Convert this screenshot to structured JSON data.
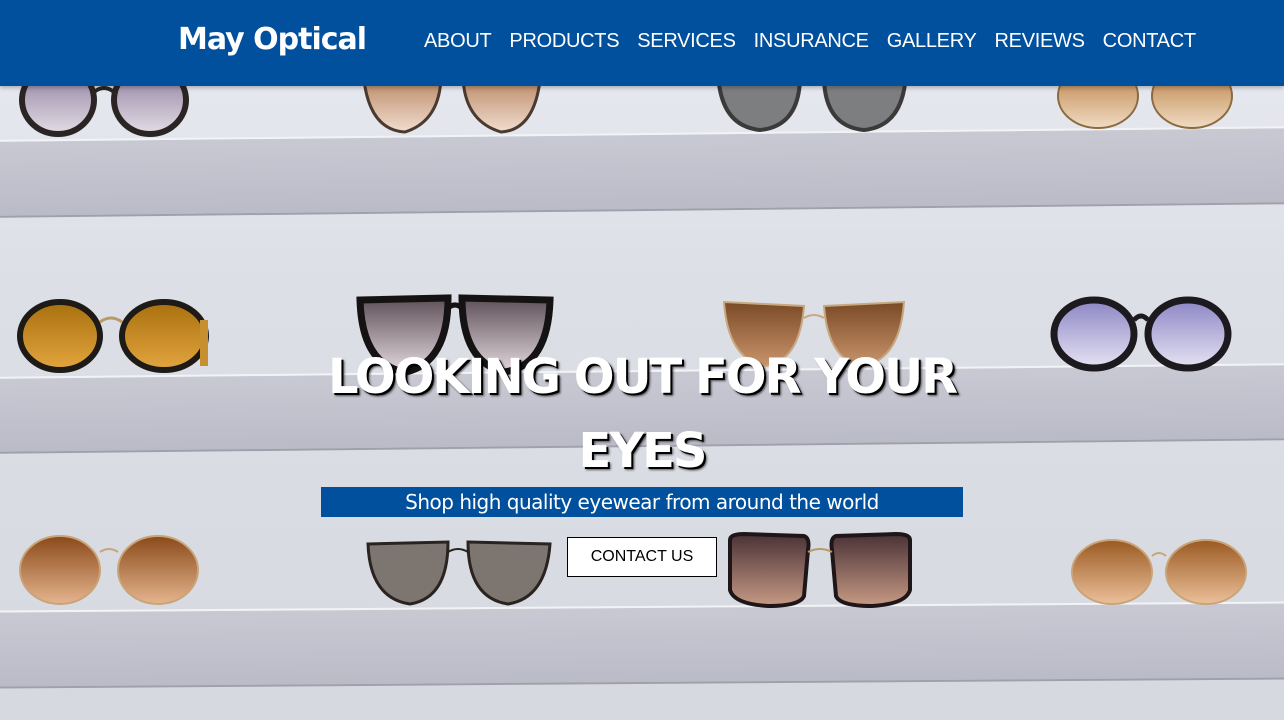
{
  "header": {
    "brand": "May Optical",
    "nav": [
      "ABOUT",
      "PRODUCTS",
      "SERVICES",
      "INSURANCE",
      "GALLERY",
      "REVIEWS",
      "CONTACT"
    ]
  },
  "hero": {
    "title": "LOOKING OUT FOR YOUR EYES",
    "tagline": "Shop high quality eyewear from around the world",
    "cta_label": "CONTACT US"
  },
  "colors": {
    "brand_blue": "#00509d",
    "text_white": "#ffffff"
  }
}
